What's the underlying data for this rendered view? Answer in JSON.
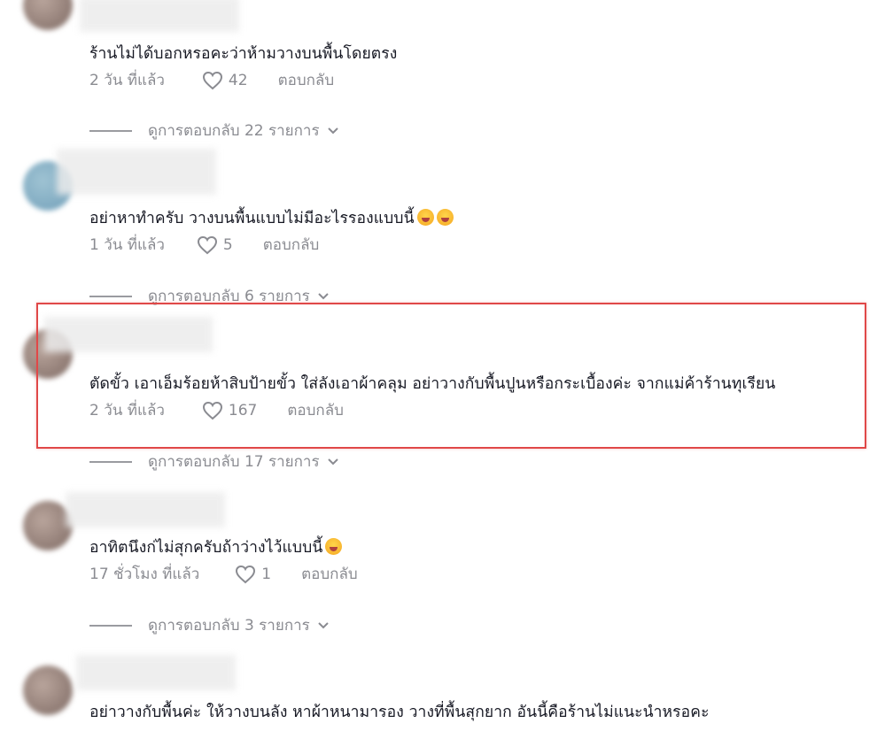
{
  "comments": [
    {
      "text": "ร้านไม่ได้บอกหรอคะว่าห้ามวางบนพื้นโดยตรง",
      "time": "2 วัน ที่แล้ว",
      "likes": "42",
      "reply_label": "ตอบกลับ",
      "view_replies": "ดูการตอบกลับ 22 รายการ"
    },
    {
      "text": "อย่าหาทำครับ วางบนพื้นแบบไม่มีอะไรรองแบบนี้",
      "time": "1 วัน ที่แล้ว",
      "likes": "5",
      "reply_label": "ตอบกลับ",
      "view_replies": "ดูการตอบกลับ 6 รายการ"
    },
    {
      "text": "ตัดขั้ว เอาเอ็มร้อยห้าสิบป้ายขั้ว ใส่ลังเอาผ้าคลุม อย่าวางกับพื้นปูนหรือกระเบื้องค่ะ จากแม่ค้าร้านทุเรียน",
      "time": "2 วัน ที่แล้ว",
      "likes": "167",
      "reply_label": "ตอบกลับ",
      "view_replies": "ดูการตอบกลับ 17 รายการ"
    },
    {
      "text": "อาทิตนึงก่ไม่สุกครับถ้าว่างไว้แบบนี้",
      "time": "17 ชั่วโมง ที่แล้ว",
      "likes": "1",
      "reply_label": "ตอบกลับ",
      "view_replies": "ดูการตอบกลับ 3 รายการ"
    },
    {
      "text": "อย่าวางกับพื้นค่ะ ให้วางบนลัง หาผ้าหนามารอง วางที่พื้นสุกยาก อันนี้คือร้านไม่แนะนำหรอคะ"
    }
  ],
  "colors": {
    "highlight_border": "#e04848",
    "meta_text": "#8a8b91",
    "comment_text": "#161823"
  }
}
